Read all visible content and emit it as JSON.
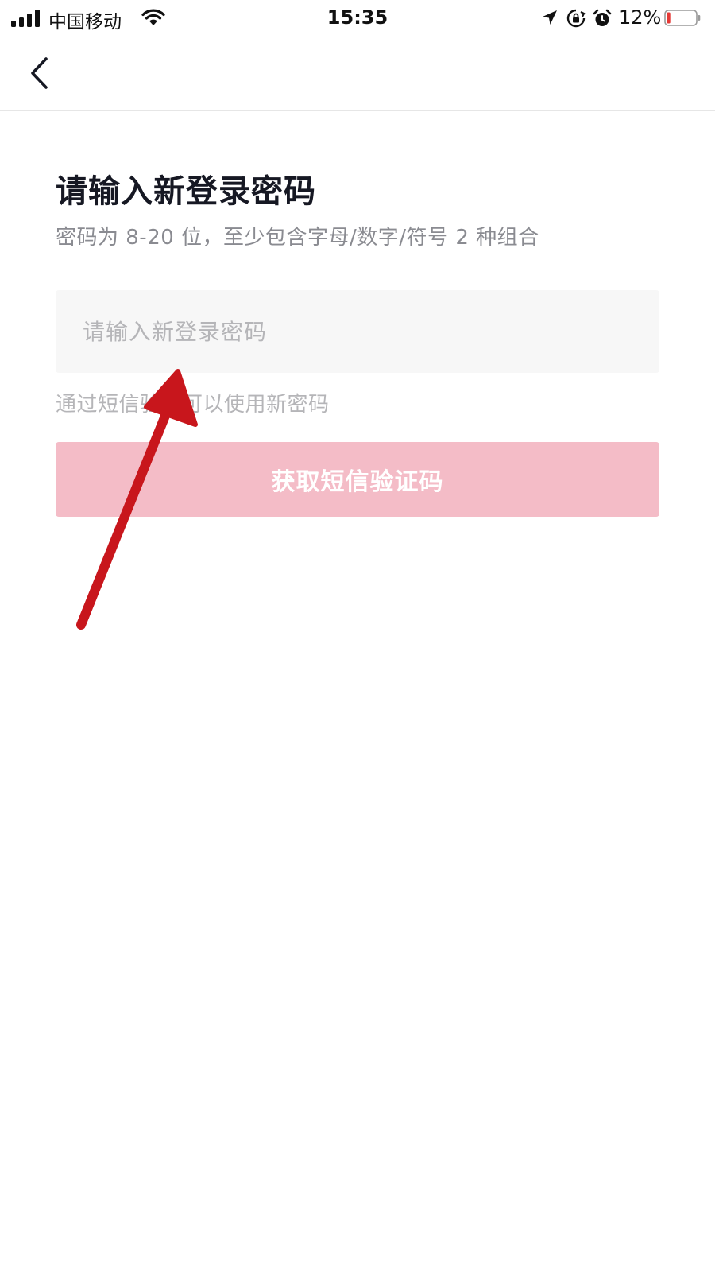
{
  "status_bar": {
    "carrier": "中国移动",
    "time": "15:35",
    "battery": "12%",
    "battery_level": 0.12,
    "battery_color": "#e53935",
    "icons": [
      "signal-icon",
      "wifi-icon",
      "location-icon",
      "orientation-lock-icon",
      "alarm-icon",
      "battery-icon"
    ]
  },
  "nav": {
    "back_icon": "chevron-left-icon"
  },
  "form": {
    "title": "请输入新登录密码",
    "subtitle": "密码为 8-20 位，至少包含字母/数字/符号 2 种组合",
    "password_placeholder": "请输入新登录密码",
    "password_value": "",
    "hint": "通过短信验证可以使用新密码",
    "submit_label": "获取短信验证码",
    "submit_color": "#f4bcc7"
  },
  "annotation": {
    "arrow_color": "#c8161c"
  }
}
